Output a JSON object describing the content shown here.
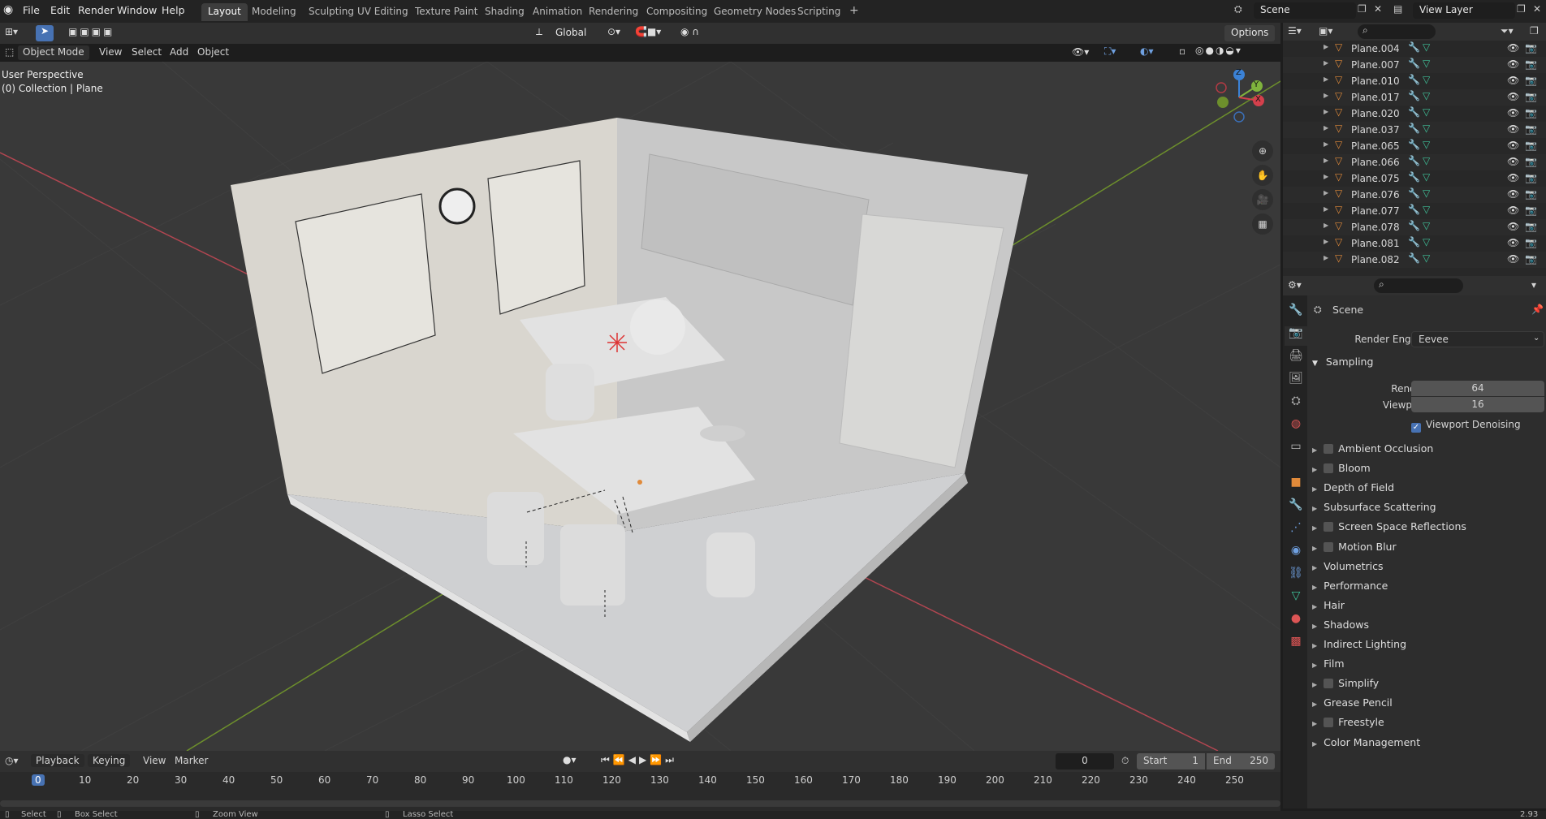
{
  "app": {
    "name": "Blender"
  },
  "menu": [
    "File",
    "Edit",
    "Render",
    "Window",
    "Help"
  ],
  "workspaces": [
    {
      "label": "Layout",
      "active": true
    },
    {
      "label": "Modeling"
    },
    {
      "label": "Sculpting"
    },
    {
      "label": "UV Editing"
    },
    {
      "label": "Texture Paint"
    },
    {
      "label": "Shading"
    },
    {
      "label": "Animation"
    },
    {
      "label": "Rendering"
    },
    {
      "label": "Compositing"
    },
    {
      "label": "Geometry Nodes"
    },
    {
      "label": "Scripting"
    }
  ],
  "add_workspace": "+",
  "scene_selector": {
    "value": "Scene"
  },
  "view_layer_selector": {
    "value": "View Layer"
  },
  "viewport_header": {
    "mode": "Object Mode",
    "menus": [
      "View",
      "Select",
      "Add",
      "Object"
    ],
    "transform_orientation": "Global",
    "options": "Options"
  },
  "viewport_overlay": {
    "perspective": "User Perspective",
    "collection": "(0) Collection | Plane"
  },
  "gizmo": {
    "z": "Z",
    "y": "Y",
    "x": "X"
  },
  "outliner": {
    "items": [
      {
        "name": "Plane.004"
      },
      {
        "name": "Plane.007"
      },
      {
        "name": "Plane.010"
      },
      {
        "name": "Plane.017"
      },
      {
        "name": "Plane.020"
      },
      {
        "name": "Plane.037"
      },
      {
        "name": "Plane.065"
      },
      {
        "name": "Plane.066"
      },
      {
        "name": "Plane.075"
      },
      {
        "name": "Plane.076"
      },
      {
        "name": "Plane.077"
      },
      {
        "name": "Plane.078"
      },
      {
        "name": "Plane.081"
      },
      {
        "name": "Plane.082"
      }
    ]
  },
  "properties": {
    "scene_name": "Scene",
    "render_engine_label": "Render Engine",
    "render_engine_value": "Eevee",
    "sampling": {
      "title": "Sampling",
      "render_label": "Render",
      "render_value": "64",
      "viewport_label": "Viewport",
      "viewport_value": "16",
      "denoise_label": "Viewport Denoising",
      "denoise_checked": true
    },
    "panels": [
      {
        "label": "Ambient Occlusion",
        "checkbox": true
      },
      {
        "label": "Bloom",
        "checkbox": true
      },
      {
        "label": "Depth of Field",
        "checkbox": false
      },
      {
        "label": "Subsurface Scattering",
        "checkbox": false
      },
      {
        "label": "Screen Space Reflections",
        "checkbox": true
      },
      {
        "label": "Motion Blur",
        "checkbox": true
      },
      {
        "label": "Volumetrics",
        "checkbox": false
      },
      {
        "label": "Performance",
        "checkbox": false
      },
      {
        "label": "Hair",
        "checkbox": false
      },
      {
        "label": "Shadows",
        "checkbox": false
      },
      {
        "label": "Indirect Lighting",
        "checkbox": false
      },
      {
        "label": "Film",
        "checkbox": false
      },
      {
        "label": "Simplify",
        "checkbox": true
      },
      {
        "label": "Grease Pencil",
        "checkbox": false
      },
      {
        "label": "Freestyle",
        "checkbox": true
      },
      {
        "label": "Color Management",
        "checkbox": false
      }
    ]
  },
  "timeline": {
    "menus": [
      "Playback",
      "Keying",
      "View",
      "Marker"
    ],
    "current_frame": "0",
    "start_label": "Start",
    "start_value": "1",
    "end_label": "End",
    "end_value": "250",
    "ruler": [
      "0",
      "10",
      "20",
      "30",
      "40",
      "50",
      "60",
      "70",
      "80",
      "90",
      "100",
      "110",
      "120",
      "130",
      "140",
      "150",
      "160",
      "170",
      "180",
      "190",
      "200",
      "210",
      "220",
      "230",
      "240",
      "250"
    ]
  },
  "statusbar": {
    "select": "Select",
    "box_select": "Box Select",
    "zoom_view": "Zoom View",
    "lasso_select": "Lasso Select",
    "version": "2.93"
  },
  "colors": {
    "accent": "#4772b3",
    "x_axis": "#d4404c",
    "y_axis": "#7fb33d",
    "z_axis": "#3b82d6",
    "object_orange": "#e08a3a",
    "mesh_green": "#3fc39a"
  }
}
